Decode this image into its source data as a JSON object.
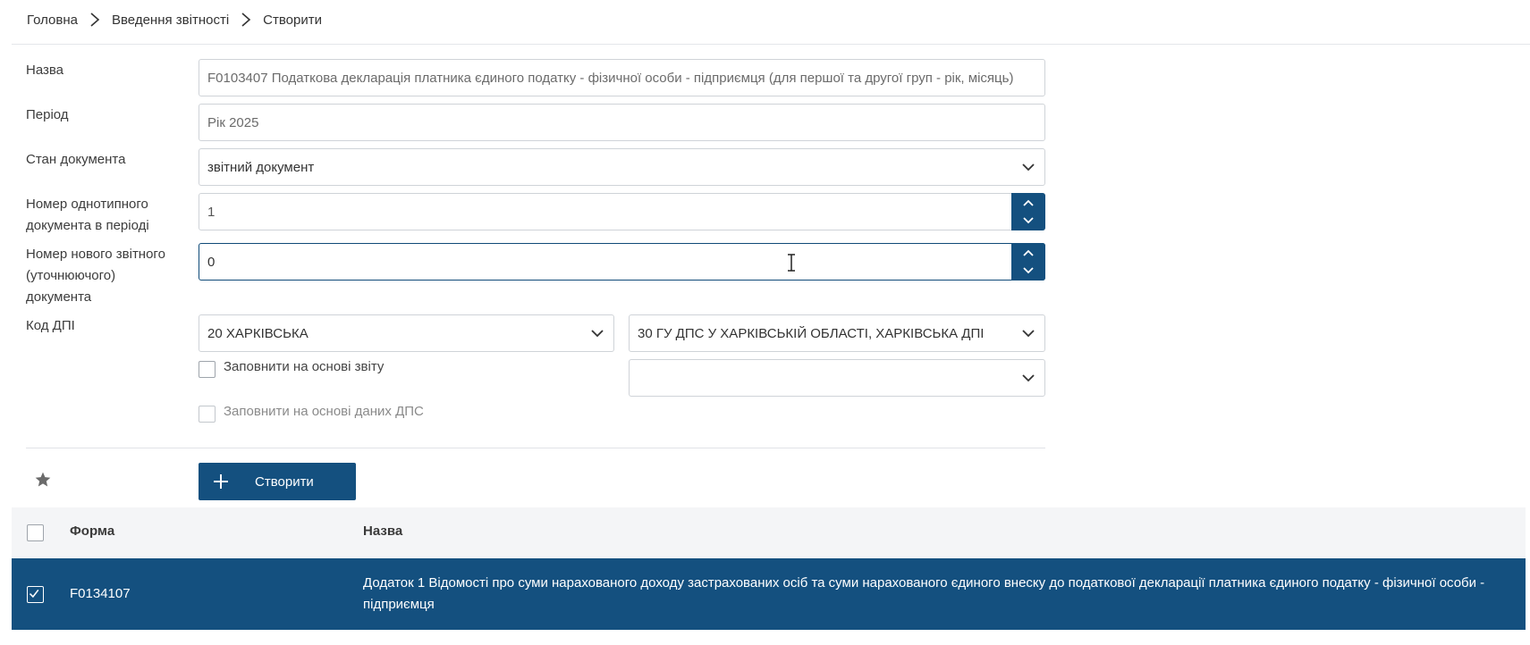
{
  "breadcrumb": [
    "Головна",
    "Введення звітності",
    "Створити"
  ],
  "form": {
    "name_label": "Назва",
    "name_value": "F0103407 Податкова декларація платника єдиного податку - фізичної особи - підприємця (для першої та другої груп - рік, місяць)",
    "period_label": "Період",
    "period_value": "Рік 2025",
    "state_label": "Стан документа",
    "state_value": "звітний документ",
    "same_type_label": "Номер однотипного документа в періоді",
    "same_type_value": "1",
    "new_report_label": "Номер нового звітного (уточнюючого) документа",
    "new_report_value": "0",
    "dpi_label": "Код ДПІ",
    "dpi_region_value": "20 ХАРКІВСЬКА",
    "dpi_office_value": "30 ГУ ДПС У ХАРКІВСЬКІЙ ОБЛАСТІ, ХАРКІВСЬКА ДПІ",
    "dpi_extra_value": "",
    "fill_from_report_label": "Заповнити на основі звіту",
    "fill_from_dps_label": "Заповнити на основі даних ДПС",
    "create_button": "Створити"
  },
  "table": {
    "headers": {
      "form": "Форма",
      "name": "Назва"
    },
    "rows": [
      {
        "checked": true,
        "form": "F0134107",
        "name": "Додаток 1 Відомості про суми нарахованого доходу застрахованих осіб та суми нарахованого єдиного внеску до податкової декларації платника єдиного податку - фізичної особи - підприємця"
      }
    ]
  },
  "colors": {
    "accent": "#14507f",
    "header_bg": "#f4f5f7",
    "border": "#cfd3d8"
  }
}
